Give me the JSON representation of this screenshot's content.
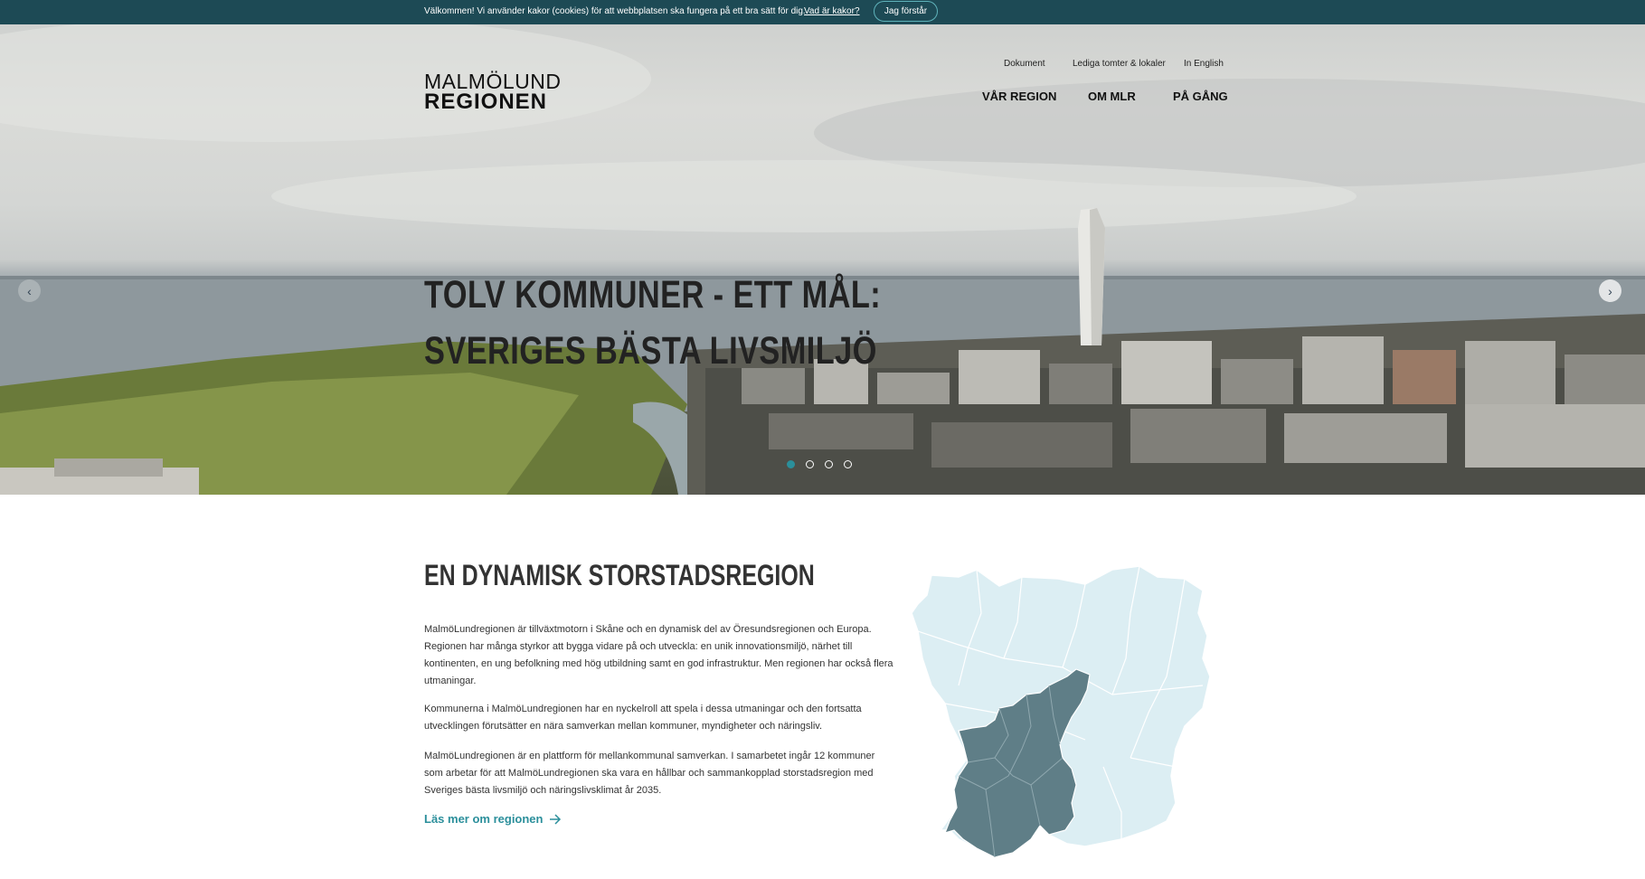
{
  "cookie": {
    "text": "Välkommen! Vi använder kakor (cookies) för att webbplatsen ska fungera på ett bra sätt för dig.",
    "link": "Vad är kakor?",
    "button": "Jag förstår"
  },
  "logo": {
    "line1": "MALMÖLUND",
    "line2": "REGIONEN"
  },
  "topnav": {
    "documents": "Dokument",
    "plots": "Lediga tomter & lokaler",
    "english": "In English"
  },
  "mainnav": {
    "region": "VÅR REGION",
    "about": "OM MLR",
    "ongoing": "PÅ GÅNG"
  },
  "hero": {
    "headline_line1": "TOLV KOMMUNER - ETT MÅL:",
    "headline_line2": "SVERIGES BÄSTA LIVSMILJÖ",
    "prev_icon": "‹",
    "next_icon": "›",
    "slide_count": 4,
    "active_slide": 1
  },
  "section": {
    "title": "EN DYNAMISK STORSTADSREGION",
    "para1": "MalmöLundregionen är tillväxtmotorn i Skåne och en dynamisk del av Öresundsregionen och Europa. Regionen har många styrkor att bygga vidare på och utveckla: en unik innovationsmiljö, närhet till kontinenten, en ung befolkning med hög utbildning samt en god infrastruktur. Men regionen har också flera utmaningar.",
    "para2": "Kommunerna i MalmöLundregionen har en nyckelroll att spela i dessa utmaningar och den fortsatta utvecklingen förutsätter en nära samverkan mellan kommuner, myndigheter och näringsliv.",
    "para3": "MalmöLundregionen är en plattform för mellankommunal samverkan. I samarbetet ingår 12 kommuner som arbetar för att MalmöLundregionen ska vara en hållbar och sammankopplad storstadsregion med Sveriges bästa livsmiljö och näringslivsklimat år 2035.",
    "readmore": "Läs mer om regionen",
    "readmore_icon": "arrow-right-icon"
  },
  "colors": {
    "accent": "#2b8f9b",
    "cookie_bg": "#1d4a55",
    "map_light": "#dceef3",
    "map_dark": "#5f7e87"
  }
}
